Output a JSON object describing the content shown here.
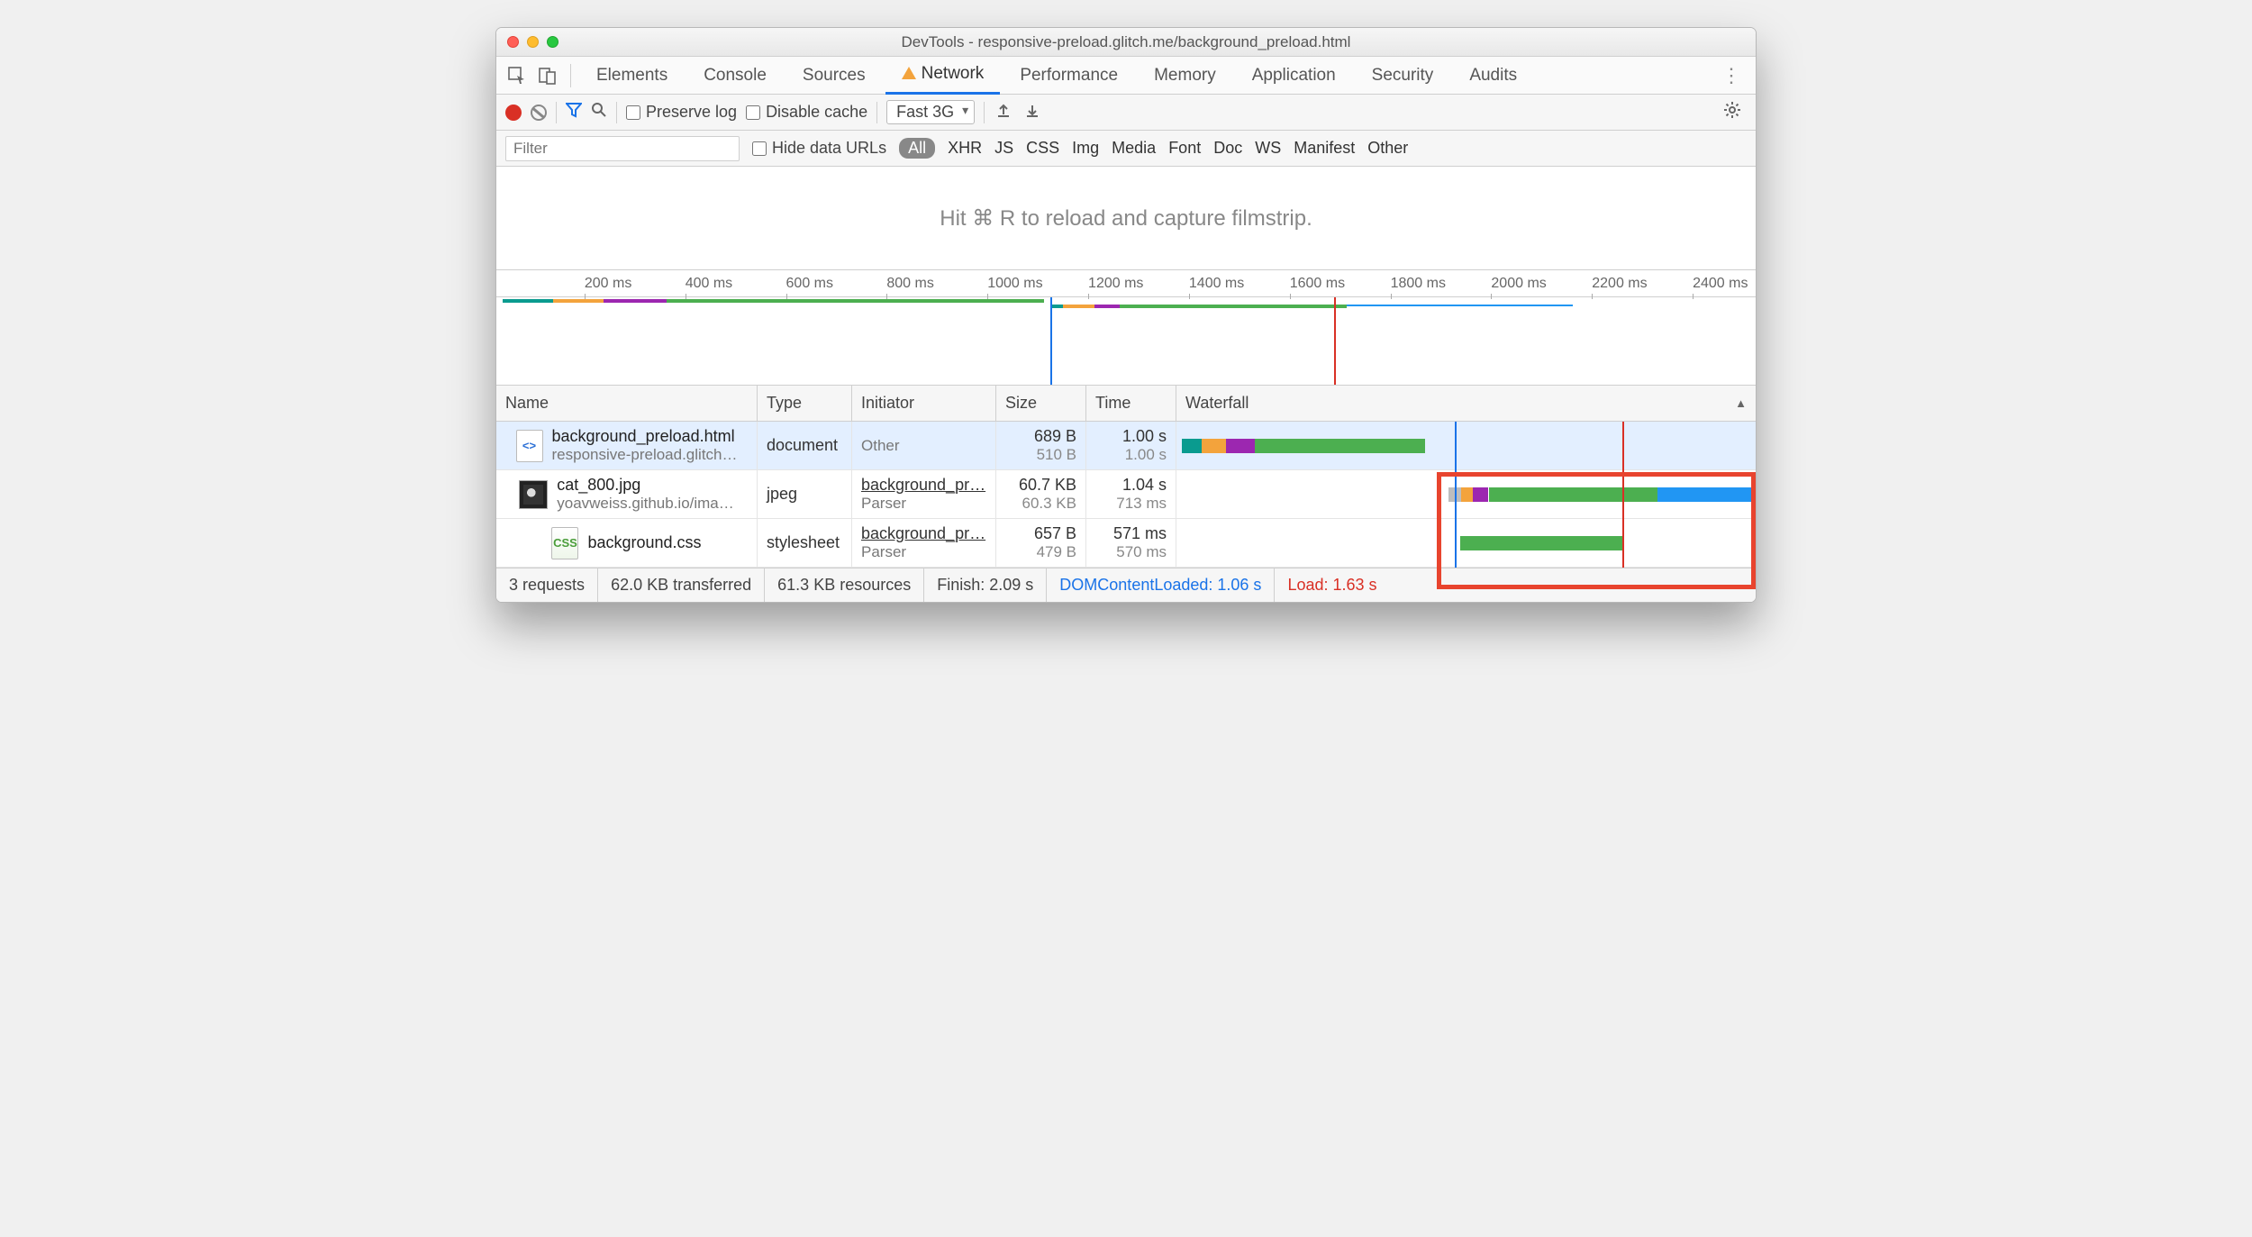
{
  "window_title": "DevTools - responsive-preload.glitch.me/background_preload.html",
  "panel_tabs": [
    "Elements",
    "Console",
    "Sources",
    "Network",
    "Performance",
    "Memory",
    "Application",
    "Security",
    "Audits"
  ],
  "active_panel": "Network",
  "toolbar": {
    "preserve_log": "Preserve log",
    "disable_cache": "Disable cache",
    "throttle": "Fast 3G"
  },
  "filterbar": {
    "placeholder": "Filter",
    "hide_data_urls": "Hide data URLs",
    "types": [
      "All",
      "XHR",
      "JS",
      "CSS",
      "Img",
      "Media",
      "Font",
      "Doc",
      "WS",
      "Manifest",
      "Other"
    ],
    "active_type": "All"
  },
  "filmstrip_hint": "Hit ⌘ R to reload and capture filmstrip.",
  "timeline_ticks": [
    "200 ms",
    "400 ms",
    "600 ms",
    "800 ms",
    "1000 ms",
    "1200 ms",
    "1400 ms",
    "1600 ms",
    "1800 ms",
    "2000 ms",
    "2200 ms",
    "2400 ms"
  ],
  "columns": {
    "name": "Name",
    "type": "Type",
    "initiator": "Initiator",
    "size": "Size",
    "time": "Time",
    "waterfall": "Waterfall"
  },
  "rows": [
    {
      "name": "background_preload.html",
      "sub": "responsive-preload.glitch…",
      "type": "document",
      "initiator": "Other",
      "initiator_sub": "",
      "size": "689 B",
      "size_sub": "510 B",
      "time": "1.00 s",
      "time_sub": "1.00 s",
      "icon": "html",
      "selected": true
    },
    {
      "name": "cat_800.jpg",
      "sub": "yoavweiss.github.io/ima…",
      "type": "jpeg",
      "initiator": "background_pr…",
      "initiator_sub": "Parser",
      "size": "60.7 KB",
      "size_sub": "60.3 KB",
      "time": "1.04 s",
      "time_sub": "713 ms",
      "icon": "img"
    },
    {
      "name": "background.css",
      "sub": "",
      "type": "stylesheet",
      "initiator": "background_pr…",
      "initiator_sub": "Parser",
      "size": "657 B",
      "size_sub": "479 B",
      "time": "571 ms",
      "time_sub": "570 ms",
      "icon": "css"
    }
  ],
  "status": {
    "requests": "3 requests",
    "transferred": "62.0 KB transferred",
    "resources": "61.3 KB resources",
    "finish": "Finish: 2.09 s",
    "dcl": "DOMContentLoaded: 1.06 s",
    "load": "Load: 1.63 s"
  },
  "colors": {
    "green": "#4caf50",
    "teal": "#0a9b8f",
    "orange": "#f3a33c",
    "purple": "#9c27b0",
    "blue": "#2196f3",
    "red": "#d83f2e",
    "dcl_blue": "#1a73e8",
    "load_red": "#d93025",
    "gray": "#bdbdbd"
  }
}
